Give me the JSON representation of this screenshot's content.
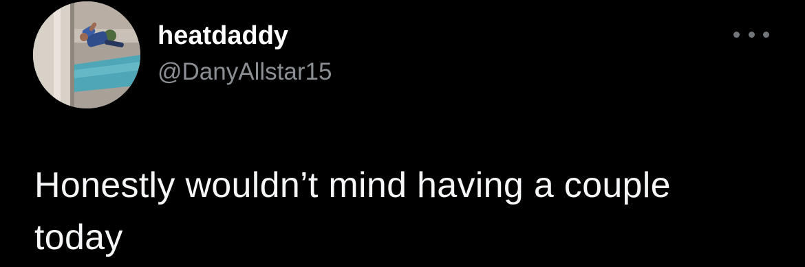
{
  "author": {
    "display_name": "heatdaddy",
    "handle": "@DanyAllstar15",
    "avatar_icon": "profile-photo"
  },
  "menu": {
    "icon": "more-options-icon"
  },
  "tweet": {
    "text": "Honestly wouldn’t mind having a couple today"
  },
  "colors": {
    "background": "#000000",
    "name": "#ffffff",
    "handle": "#8b8f94",
    "text": "#f5f6f7"
  }
}
